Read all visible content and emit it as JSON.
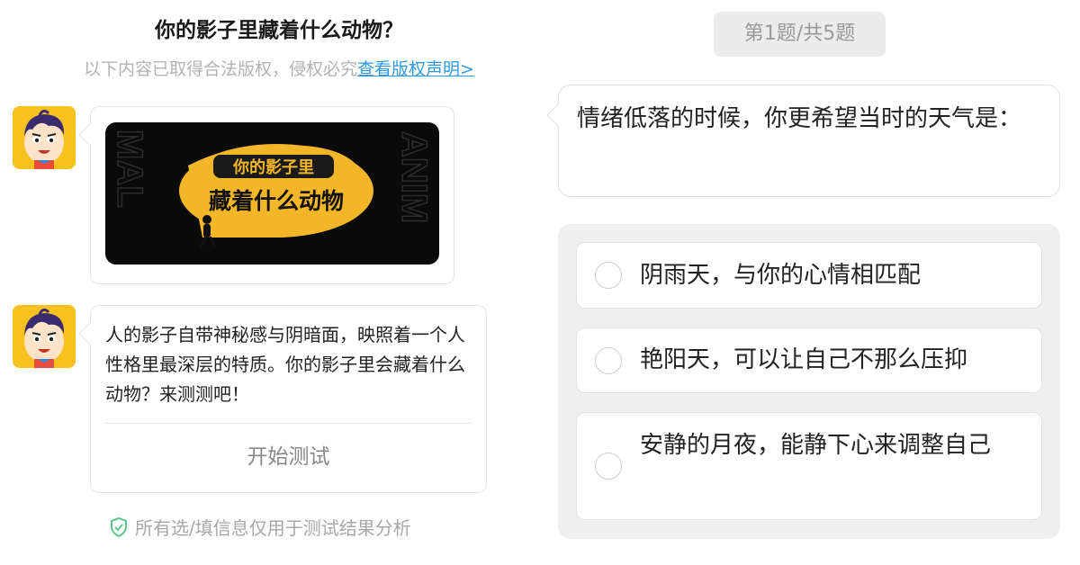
{
  "header": {
    "title": "你的影子里藏着什么动物？",
    "copyright_text": "以下内容已取得合法版权，侵权必究",
    "copyright_link": "查看版权声明>"
  },
  "cover": {
    "line1": "你的影子里",
    "line2": "藏着什么动物",
    "side_left": "MAL",
    "side_right": "ANIM"
  },
  "intro": {
    "text": "人的影子自带神秘感与阴暗面，映照着一个人性格里最深层的特质。你的影子里会藏着什么动物？来测测吧！",
    "start_button": "开始测试"
  },
  "privacy_note": "所有选/填信息仅用于测试结果分析",
  "quiz": {
    "progress": "第1题/共5题",
    "question": "情绪低落的时候，你更希望当时的天气是：",
    "options": [
      {
        "label": "阴雨天，与你的心情相匹配"
      },
      {
        "label": "艳阳天，可以让自己不那么压抑"
      },
      {
        "label": "安静的月夜，能静下心来调整自己"
      }
    ]
  },
  "colors": {
    "link": "#2f9ae4",
    "avatar_bg": "#f7c21f",
    "cover_highlight": "#f4b629",
    "privacy_icon": "#5cc58a"
  }
}
